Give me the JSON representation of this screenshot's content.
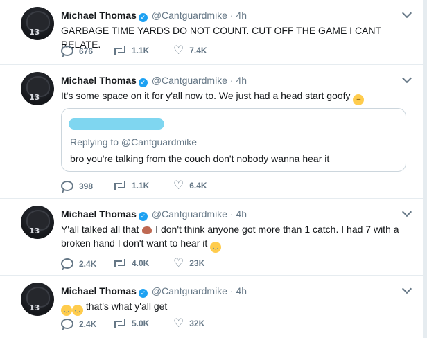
{
  "tweets": [
    {
      "name": "Michael Thomas",
      "handle": "@Cantguardmike",
      "separator": "·",
      "time": "4h",
      "text": "GARBAGE TIME YARDS DO NOT COUNT. CUT OFF THE GAME I CANT RELATE.",
      "replies": "676",
      "retweets": "1.1K",
      "likes": "7.4K"
    },
    {
      "name": "Michael Thomas",
      "handle": "@Cantguardmike",
      "separator": "·",
      "time": "4h",
      "text": "It's some space on it for y'all now to. We just had a head start goofy",
      "quote": {
        "replying_to": "Replying to @Cantguardmike",
        "text": "bro you're talking from the couch don't nobody wanna hear it"
      },
      "replies": "398",
      "retweets": "1.1K",
      "likes": "6.4K"
    },
    {
      "name": "Michael Thomas",
      "handle": "@Cantguardmike",
      "separator": "·",
      "time": "4h",
      "text_part1": "Y'all talked all that",
      "text_part2": " I don't think anyone got more than 1 catch.  I had 7 with a broken hand I don't want to hear it",
      "replies": "2.4K",
      "retweets": "4.0K",
      "likes": "23K"
    },
    {
      "name": "Michael Thomas",
      "handle": "@Cantguardmike",
      "separator": "·",
      "time": "4h",
      "text": " that's what y'all get",
      "replies": "2.4K",
      "retweets": "5.0K",
      "likes": "32K"
    }
  ],
  "avatar_number": "13",
  "icons": {
    "verified": "verified-badge-icon",
    "reply": "reply-icon",
    "retweet": "retweet-icon",
    "like": "heart-icon",
    "more": "chevron-down-icon"
  },
  "colors": {
    "verified": "#1da1f2",
    "muted": "#657786",
    "border": "#e6ecf0"
  }
}
